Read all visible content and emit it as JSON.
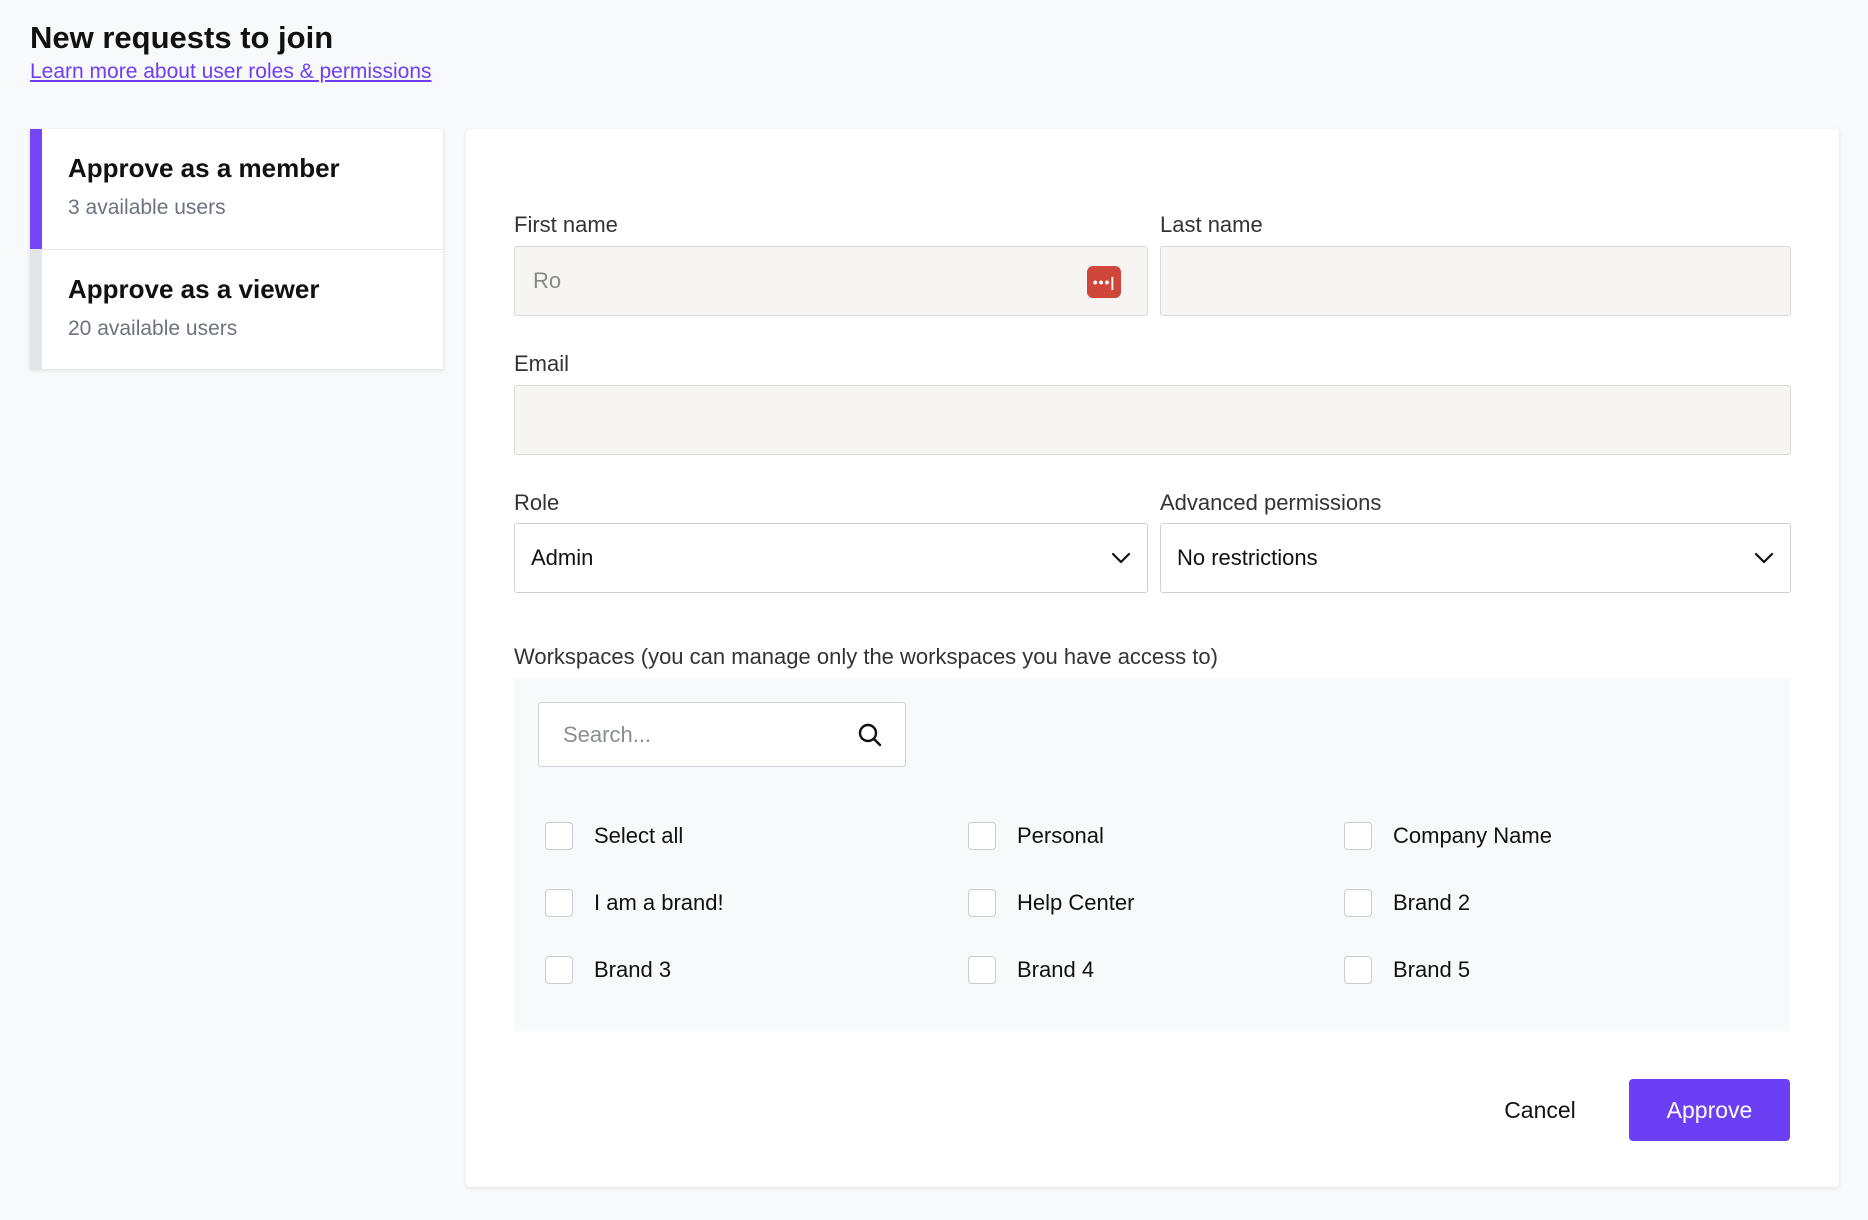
{
  "header": {
    "title": "New requests to join",
    "link": "Learn more about user roles & permissions"
  },
  "options": [
    {
      "title": "Approve as a member",
      "subtitle": "3 available users",
      "active": true
    },
    {
      "title": "Approve as a viewer",
      "subtitle": "20 available users",
      "active": false
    }
  ],
  "form": {
    "first_name": {
      "label": "First name",
      "value": "Ro"
    },
    "last_name": {
      "label": "Last name",
      "value": ""
    },
    "email": {
      "label": "Email",
      "value": ""
    },
    "role": {
      "label": "Role",
      "value": "Admin"
    },
    "advanced": {
      "label": "Advanced permissions",
      "value": "No restrictions"
    }
  },
  "workspaces": {
    "label": "Workspaces (you can manage only the workspaces you have access to)",
    "search_placeholder": "Search...",
    "items": [
      "Select all",
      "Personal",
      "Company Name",
      "I am a brand!",
      "Help Center",
      "Brand 2",
      "Brand 3",
      "Brand 4",
      "Brand 5"
    ]
  },
  "actions": {
    "cancel": "Cancel",
    "approve": "Approve"
  },
  "colors": {
    "accent": "#6c3ff5",
    "password_icon": "#d0463b"
  },
  "icons": {
    "password_manager": "password-manager-icon",
    "chevron": "chevron-down-icon",
    "search": "search-icon"
  }
}
